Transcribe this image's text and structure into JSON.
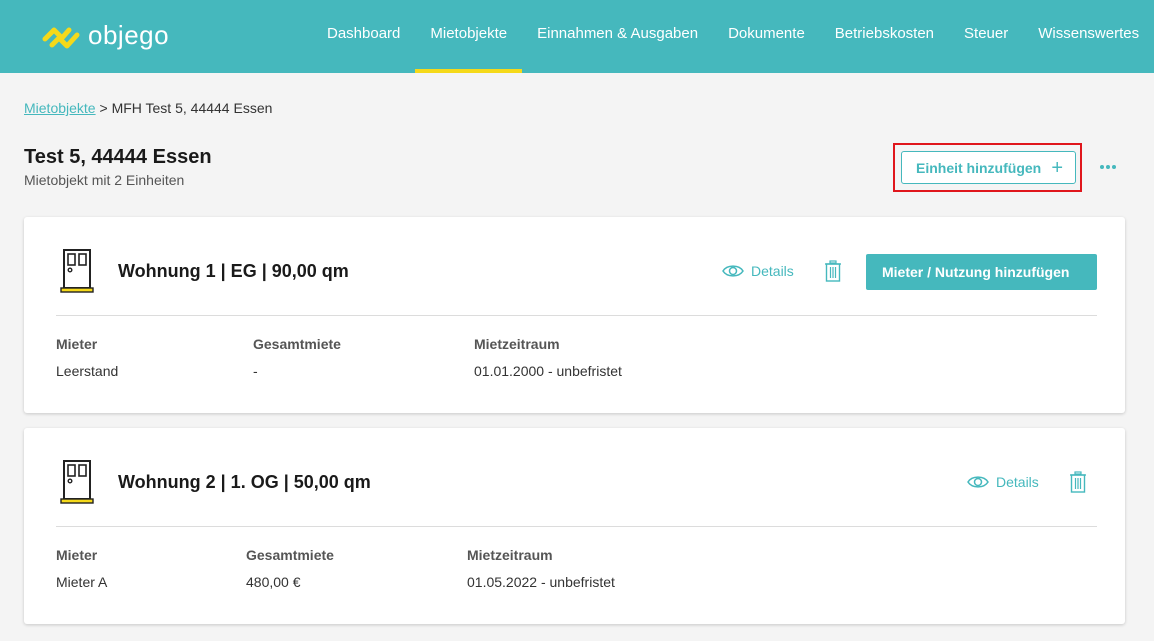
{
  "brand": {
    "name": "objego"
  },
  "nav": [
    {
      "label": "Dashboard",
      "active": false
    },
    {
      "label": "Mietobjekte",
      "active": true
    },
    {
      "label": "Einnahmen & Ausgaben",
      "active": false
    },
    {
      "label": "Dokumente",
      "active": false
    },
    {
      "label": "Betriebskosten",
      "active": false
    },
    {
      "label": "Steuer",
      "active": false
    },
    {
      "label": "Wissenswertes",
      "active": false
    }
  ],
  "breadcrumb": {
    "link": "Mietobjekte",
    "separator": ">",
    "current": "MFH Test 5, 44444 Essen"
  },
  "page": {
    "title": "Test 5, 44444 Essen",
    "subtitle": "Mietobjekt mit 2 Einheiten",
    "add_unit_label": "Einheit hinzufügen",
    "add_unit_icon": "+"
  },
  "colors": {
    "accent": "#45b8bd",
    "nav_active": "#f5d91a",
    "highlight": "#e0161c"
  },
  "units": [
    {
      "title": "Wohnung 1 | EG | 90,00 qm",
      "details_label": "Details",
      "add_tenant_label": "Mieter / Nutzung hinzufügen",
      "columns": {
        "tenant": "Mieter",
        "rent": "Gesamtmiete",
        "period": "Mietzeitraum"
      },
      "values": {
        "tenant": "Leerstand",
        "rent": "-",
        "period": "01.01.2000 - unbefristet"
      }
    },
    {
      "title": "Wohnung 2 | 1. OG | 50,00 qm",
      "details_label": "Details",
      "columns": {
        "tenant": "Mieter",
        "rent": "Gesamtmiete",
        "period": "Mietzeitraum"
      },
      "values": {
        "tenant": "Mieter A",
        "rent": "480,00 €",
        "period": "01.05.2022 - unbefristet"
      }
    }
  ]
}
